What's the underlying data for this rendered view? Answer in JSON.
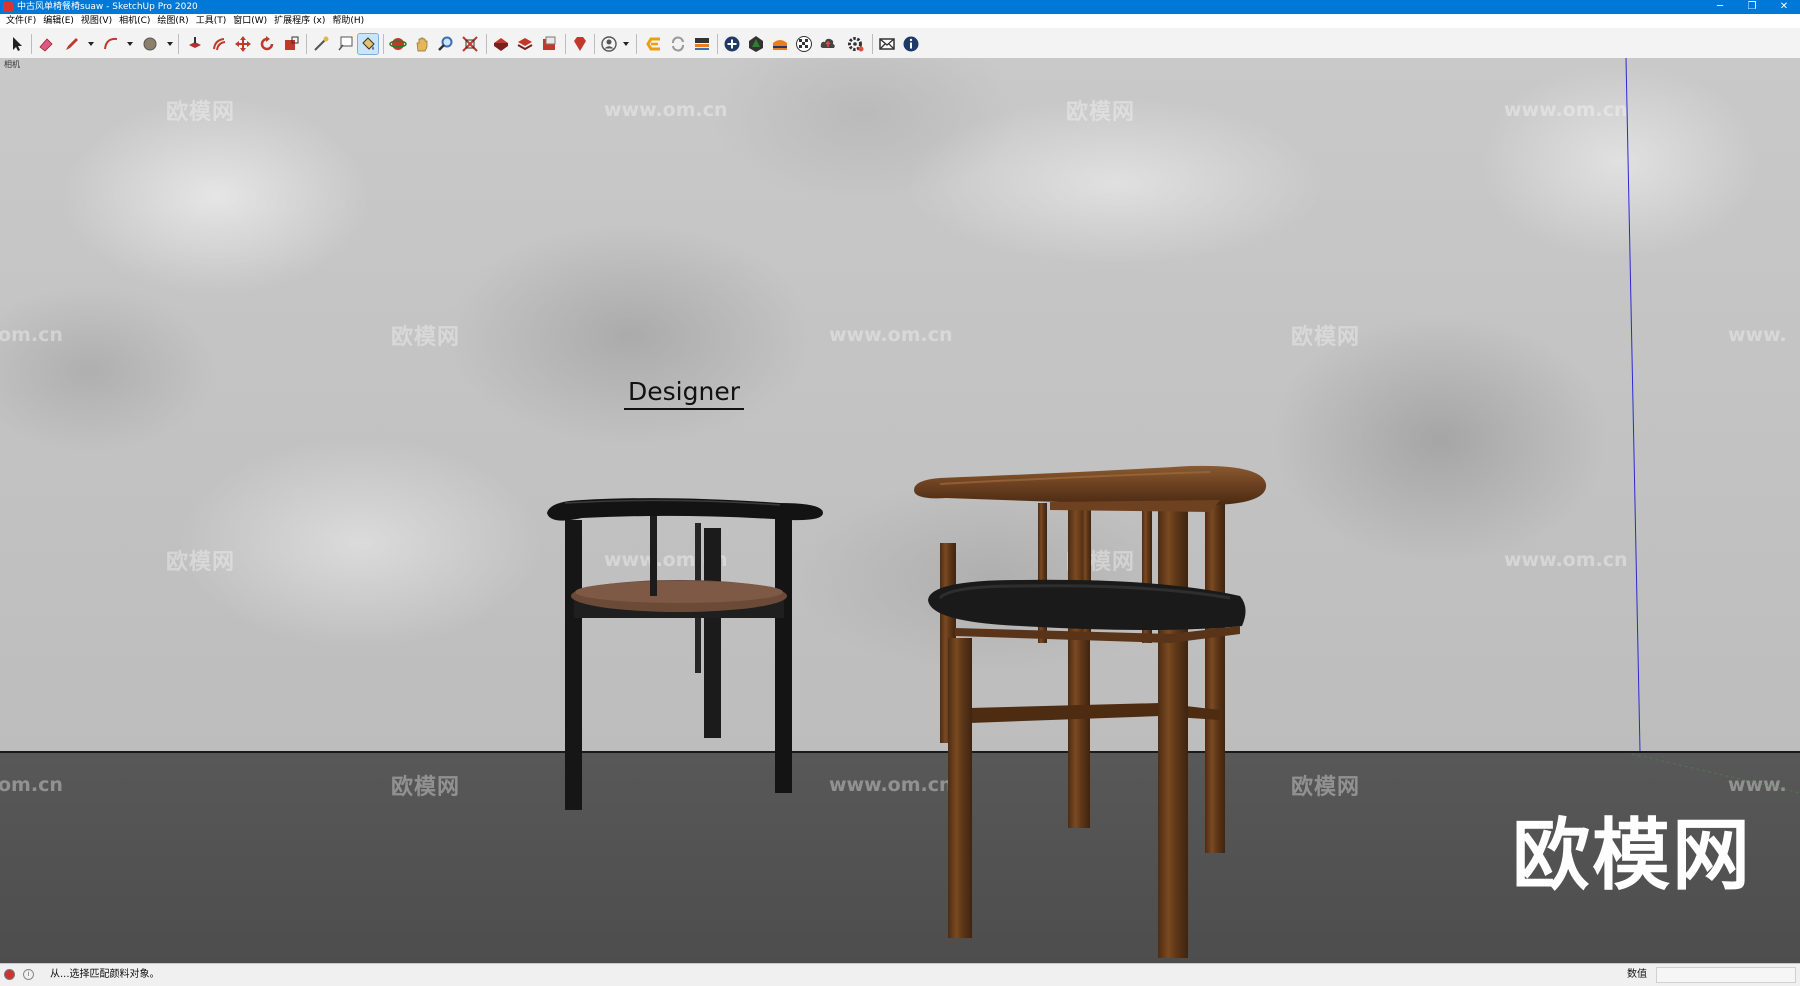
{
  "window": {
    "title": "中古风单椅餐椅suaw - SketchUp Pro 2020",
    "controls": {
      "minimize": "─",
      "restore": "❐",
      "close": "✕"
    }
  },
  "menu": [
    "文件(F)",
    "编辑(E)",
    "视图(V)",
    "相机(C)",
    "绘图(R)",
    "工具(T)",
    "窗口(W)",
    "扩展程序 (x)",
    "帮助(H)"
  ],
  "toolbar": {
    "tools": [
      {
        "name": "select-tool",
        "icon": "arrow-cursor-icon",
        "color": "#222222"
      },
      {
        "name": "eraser-tool",
        "icon": "eraser-icon",
        "color": "#e0588a"
      },
      {
        "name": "line-tool",
        "icon": "pencil-icon",
        "color": "#c0392b"
      },
      {
        "name": "arc-tool",
        "icon": "arc-icon",
        "color": "#c0392b"
      },
      {
        "name": "shapes-tool",
        "icon": "circle-icon",
        "color": "#8d7f6a"
      },
      {
        "name": "push-pull-tool",
        "icon": "push-pull-icon",
        "color": "#b03030"
      },
      {
        "name": "offset-tool",
        "icon": "offset-icon",
        "color": "#c0392b"
      },
      {
        "name": "move-tool",
        "icon": "move-icon",
        "color": "#c0392b"
      },
      {
        "name": "rotate-tool",
        "icon": "rotate-icon",
        "color": "#c0392b"
      },
      {
        "name": "scale-tool",
        "icon": "scale-icon",
        "color": "#c0392b"
      },
      {
        "name": "tape-measure-tool",
        "icon": "tape-measure-icon",
        "color": "#555555"
      },
      {
        "name": "text-tool",
        "icon": "text-icon",
        "color": "#555555"
      },
      {
        "name": "paint-bucket-tool",
        "icon": "paint-bucket-icon",
        "color": "#3b6fb5"
      },
      {
        "name": "orbit-tool",
        "icon": "orbit-icon",
        "color": "#c0392b"
      },
      {
        "name": "pan-tool",
        "icon": "hand-icon",
        "color": "#d6a23c"
      },
      {
        "name": "zoom-tool",
        "icon": "magnifier-icon",
        "color": "#3b6fb5"
      },
      {
        "name": "zoom-extents-tool",
        "icon": "zoom-extents-icon",
        "color": "#c0392b"
      },
      {
        "name": "warehouse-tool",
        "icon": "warehouse-icon",
        "color": "#c0392b"
      },
      {
        "name": "share-model-tool",
        "icon": "share-model-icon",
        "color": "#c0392b"
      },
      {
        "name": "extension-warehouse-tool",
        "icon": "extension-warehouse-icon",
        "color": "#c0392b"
      },
      {
        "name": "ruby-tool",
        "icon": "ruby-icon",
        "color": "#c0392b"
      },
      {
        "name": "user-account-tool",
        "icon": "user-account-icon",
        "color": "#555555"
      },
      {
        "name": "enscape-tool",
        "icon": "enscape-icon",
        "color": "#e8a010"
      },
      {
        "name": "sync-tool",
        "icon": "sync-icon",
        "color": "#999999"
      },
      {
        "name": "render-tool",
        "icon": "render-icon",
        "color": "#333333"
      },
      {
        "name": "add-tool",
        "icon": "plus-circle-icon",
        "color": "#1f3a66"
      },
      {
        "name": "tree-tool",
        "icon": "tree-icon",
        "color": "#2e7d32"
      },
      {
        "name": "material-tool",
        "icon": "material-icon",
        "color": "#e67e22"
      },
      {
        "name": "checker-tool",
        "icon": "checker-icon",
        "color": "#333333"
      },
      {
        "name": "cloud-tool",
        "icon": "cloud-upload-icon",
        "color": "#444444"
      },
      {
        "name": "settings-tool",
        "icon": "gear-icon",
        "color": "#333333"
      },
      {
        "name": "mail-tool",
        "icon": "envelope-icon",
        "color": "#333333"
      },
      {
        "name": "info-tool",
        "icon": "info-icon",
        "color": "#1f3a66"
      }
    ]
  },
  "viewport": {
    "scene_label": "相机",
    "designer_text": "Designer",
    "watermark_cn": "欧模网",
    "watermark_url": "www.om.cn",
    "watermark_url_partial": "om.cn",
    "watermark_url_partial_right": "www.",
    "wall_color": "#c4c4c4",
    "floor_color": "#545454",
    "blue_axis_color": "#2a2ad0"
  },
  "status": {
    "message": "从...选择匹配颜料对象。",
    "measure_label": "数值",
    "measure_value": ""
  }
}
